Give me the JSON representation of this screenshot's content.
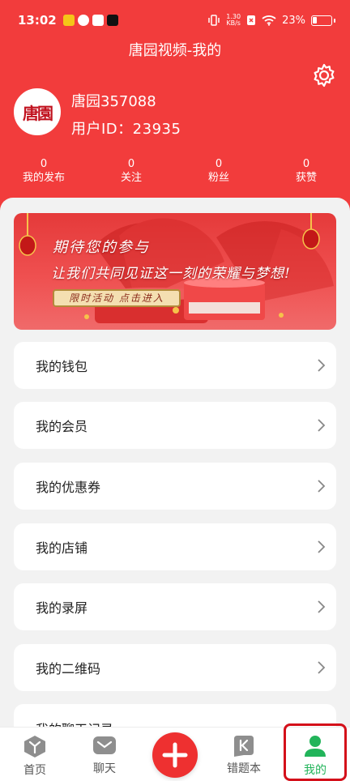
{
  "status": {
    "time": "13:02",
    "speed_top": "1.30",
    "speed_bottom": "KB/s",
    "battery": "23%"
  },
  "header": {
    "title": "唐园视频-我的",
    "avatar_text": "唐園",
    "username": "唐园357088",
    "user_id": "用户ID：23935"
  },
  "stats": [
    {
      "value": "0",
      "label": "我的发布"
    },
    {
      "value": "0",
      "label": "关注"
    },
    {
      "value": "0",
      "label": "粉丝"
    },
    {
      "value": "0",
      "label": "获赞"
    }
  ],
  "banner": {
    "line1": "期待您的参与",
    "line2": "让我们共同见证这一刻的荣耀与梦想!",
    "tag": "限时活动 点击进入"
  },
  "menu": [
    {
      "label": "我的钱包"
    },
    {
      "label": "我的会员"
    },
    {
      "label": "我的优惠券"
    },
    {
      "label": "我的店铺"
    },
    {
      "label": "我的录屏"
    },
    {
      "label": "我的二维码"
    },
    {
      "label": "我的聊天记录"
    }
  ],
  "nav": {
    "home": "首页",
    "chat": "聊天",
    "wrongbook": "错题本",
    "mine": "我的"
  },
  "colors": {
    "brand_red": "#f23c3c",
    "active_green": "#22b45a"
  }
}
